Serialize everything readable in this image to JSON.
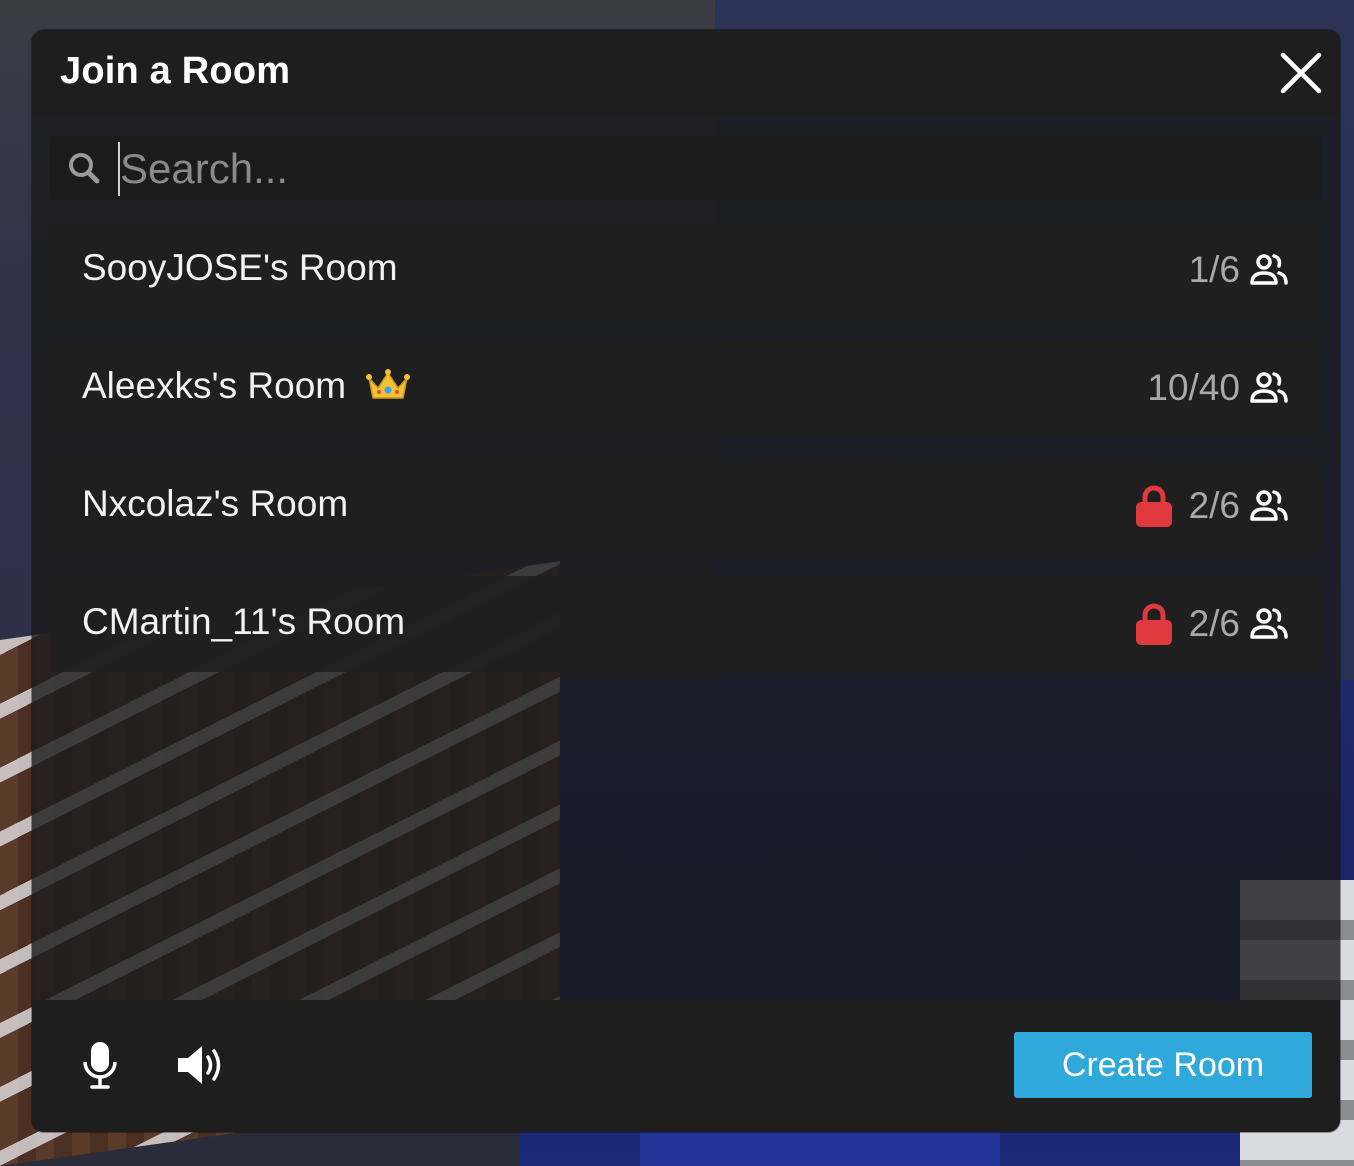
{
  "dialog": {
    "title": "Join a Room",
    "close_icon": "close-icon"
  },
  "search": {
    "placeholder": "Search...",
    "value": "",
    "icon": "search-icon"
  },
  "rooms": [
    {
      "name": "SooyJOSE's Room",
      "players": "1/6",
      "locked": false,
      "crown": false
    },
    {
      "name": "Aleexks's Room",
      "players": "10/40",
      "locked": false,
      "crown": true
    },
    {
      "name": "Nxcolaz's Room",
      "players": "2/6",
      "locked": true,
      "crown": false
    },
    {
      "name": "CMartin_11's Room",
      "players": "2/6",
      "locked": true,
      "crown": false
    }
  ],
  "footer": {
    "mic_icon": "microphone-icon",
    "speaker_icon": "speaker-icon",
    "create_label": "Create Room"
  },
  "colors": {
    "accent": "#2fa8dc",
    "lock": "#e0393e",
    "crown": "#f1c232",
    "count_text": "#a9a9a9"
  }
}
